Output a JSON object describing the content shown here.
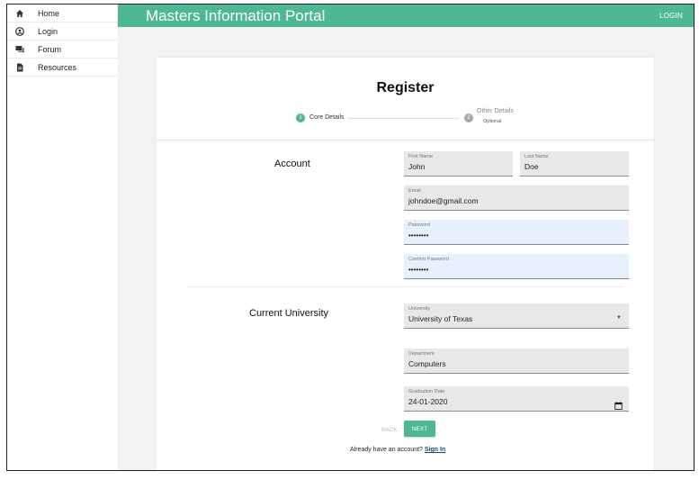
{
  "sidebar": {
    "items": [
      {
        "label": "Home",
        "icon": "home-icon"
      },
      {
        "label": "Login",
        "icon": "account-circle-icon"
      },
      {
        "label": "Forum",
        "icon": "forum-icon"
      },
      {
        "label": "Resources",
        "icon": "document-icon"
      }
    ]
  },
  "appbar": {
    "title": "Masters Information Portal",
    "login_label": "LOGIN",
    "color": "#4db892"
  },
  "register": {
    "title": "Register",
    "steps": [
      {
        "number": "1",
        "label": "Core Details",
        "active": true
      },
      {
        "number": "2",
        "label": "Other Details",
        "sublabel": "Optional",
        "active": false
      }
    ],
    "account_section": "Account",
    "university_section": "Current University",
    "fields": {
      "first_name": {
        "label": "First Name",
        "value": "John"
      },
      "last_name": {
        "label": "Last Name",
        "value": "Doe"
      },
      "email": {
        "label": "Email",
        "value": "johndoe@gmail.com"
      },
      "password": {
        "label": "Password",
        "value": "••••••••"
      },
      "confirm_password": {
        "label": "Confirm Password",
        "value": "••••••••"
      },
      "university": {
        "label": "University",
        "value": "University of Texas"
      },
      "department": {
        "label": "Department",
        "value": "Computers"
      },
      "graduation_date": {
        "label": "Graduation Date",
        "value": "24-01-2020"
      }
    },
    "back_label": "BACK",
    "next_label": "NEXT",
    "already_text": "Already have an account?",
    "signin_label": "Sign In"
  }
}
